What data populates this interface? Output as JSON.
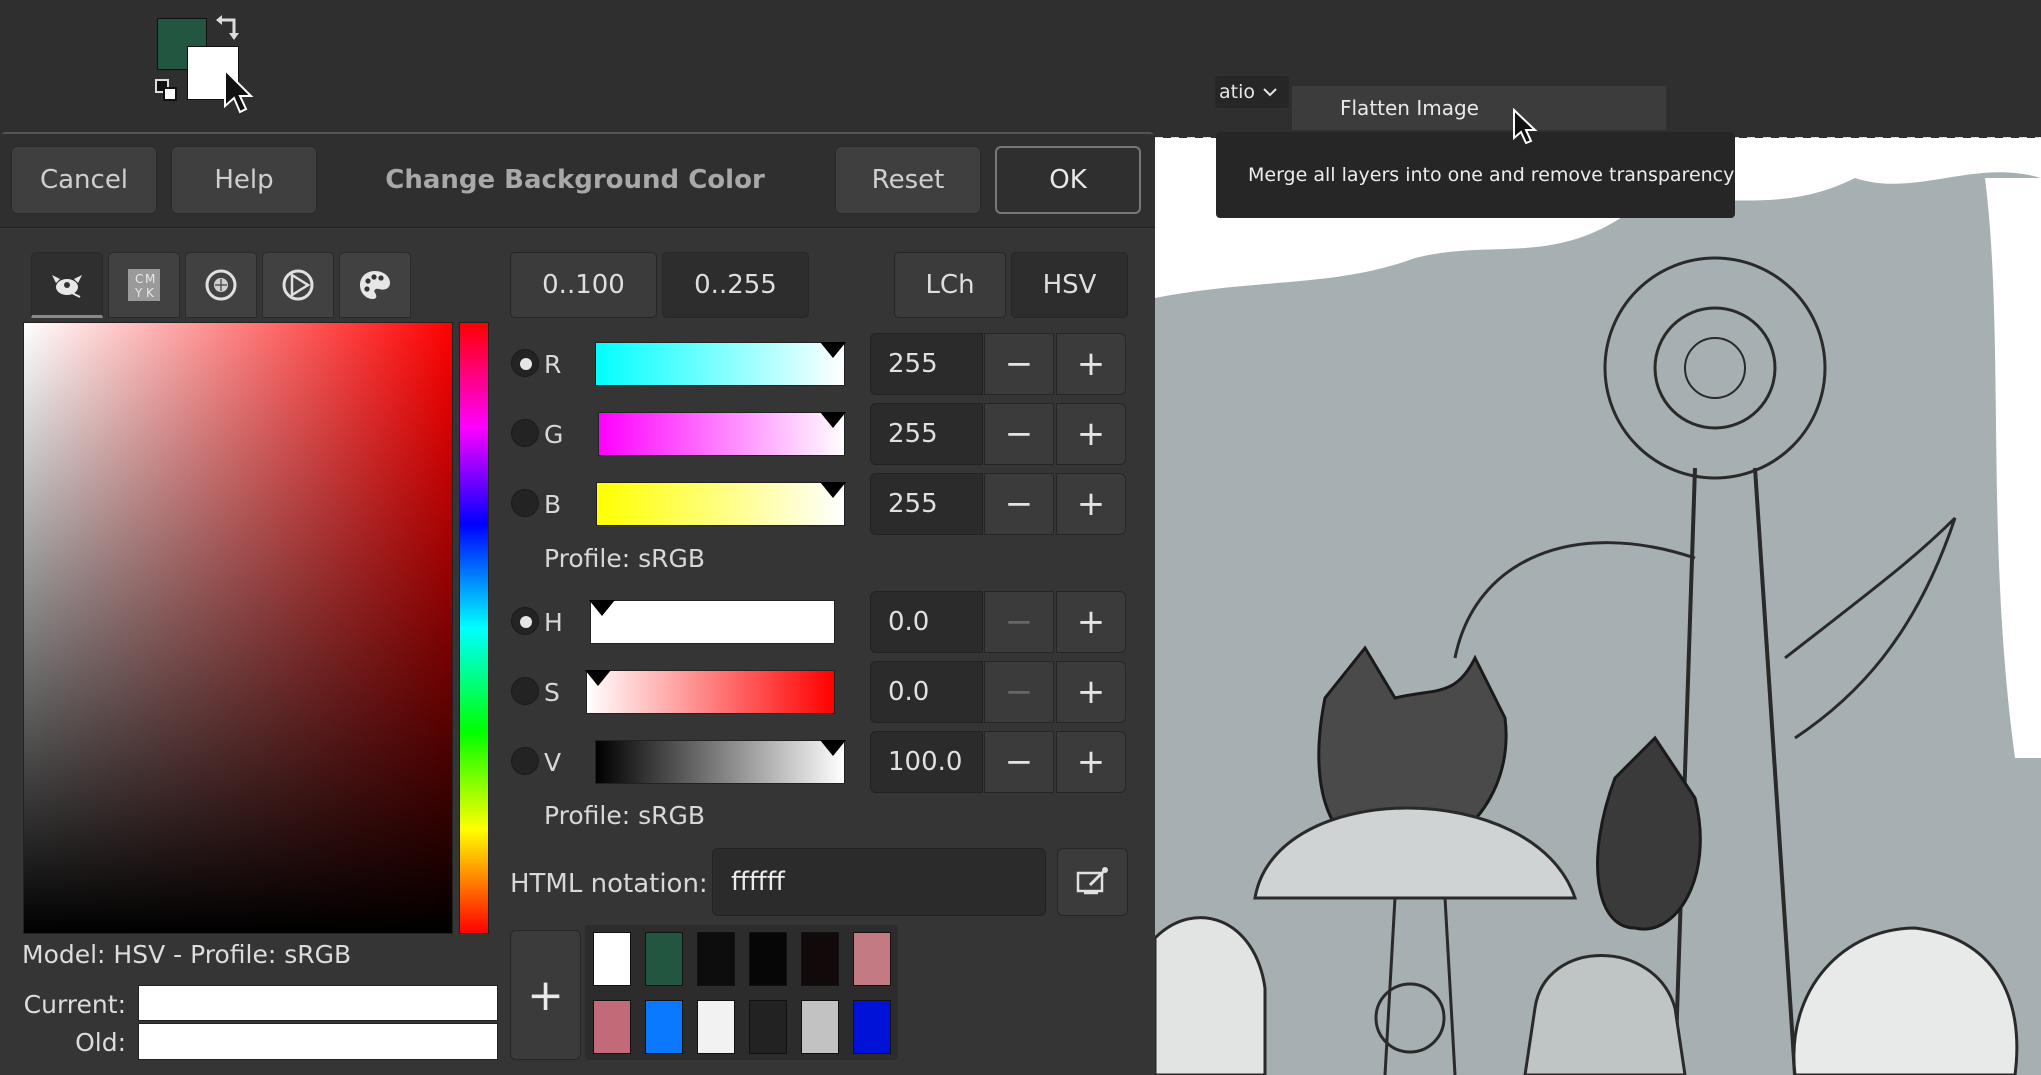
{
  "toolbox": {
    "foreground_color": "#235641",
    "background_color": "#ffffff"
  },
  "menu": {
    "ratio_text": "atio",
    "flatten_label": "Flatten Image",
    "tooltip": "Merge all layers into one and remove transparency"
  },
  "dialog": {
    "title": "Change Background Color",
    "cancel_label": "Cancel",
    "help_label": "Help",
    "reset_label": "Reset",
    "ok_label": "OK"
  },
  "selector_tabs": [
    {
      "icon": "gimp-icon"
    },
    {
      "icon": "cmyk-icon"
    },
    {
      "icon": "wheel-icon"
    },
    {
      "icon": "triangle-icon"
    },
    {
      "icon": "palette-icon"
    }
  ],
  "model_label": "Model: HSV - Profile: sRGB",
  "current_label": "Current:",
  "old_label": "Old:",
  "current_color": "#ffffff",
  "old_color": "#ffffff",
  "range_buttons": {
    "r100": "0..100",
    "r255": "0..255"
  },
  "model_buttons": {
    "lch": "LCh",
    "hsv": "HSV"
  },
  "rgb": {
    "r": {
      "label": "R",
      "value": "255",
      "selected": true
    },
    "g": {
      "label": "G",
      "value": "255",
      "selected": false
    },
    "b": {
      "label": "B",
      "value": "255",
      "selected": false
    },
    "profile": "Profile: sRGB"
  },
  "hsv": {
    "h": {
      "label": "H",
      "value": "0.0",
      "selected": true
    },
    "s": {
      "label": "S",
      "value": "0.0",
      "selected": false
    },
    "v": {
      "label": "V",
      "value": "100.0",
      "selected": false
    },
    "profile": "Profile: sRGB"
  },
  "html_notation": {
    "label": "HTML notation:",
    "value": "ffffff"
  },
  "history": {
    "add_label": "+",
    "colors": [
      "#ffffff",
      "#235641",
      "#0d0d0d",
      "#060606",
      "#120a0a",
      "#c47a82",
      "#c26a78",
      "#0a78ff",
      "#f2f2f2",
      "#222222",
      "#c2c2c2",
      "#0012d8"
    ]
  }
}
